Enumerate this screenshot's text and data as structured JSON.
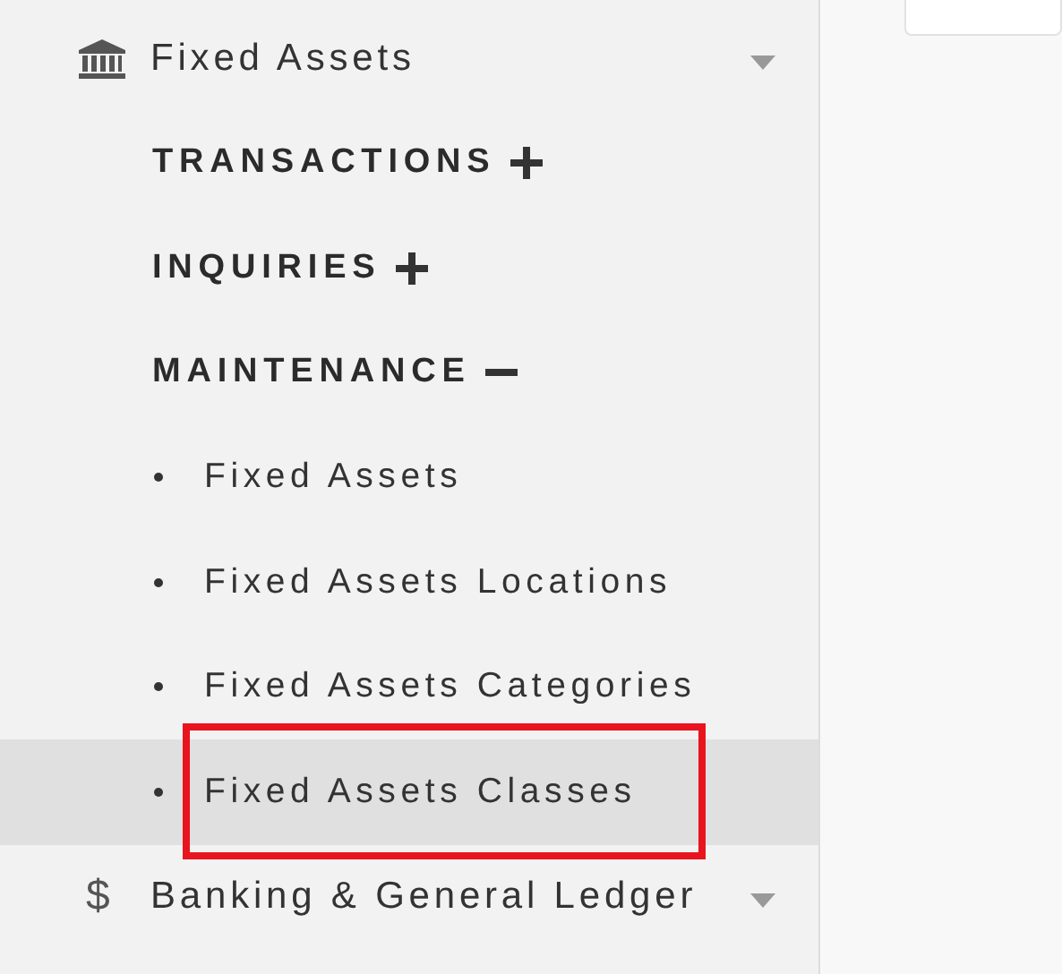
{
  "sidebar": {
    "items": [
      {
        "label": "Fixed Assets",
        "icon": {
          "kind": "bank"
        },
        "expanded": true,
        "sections": [
          {
            "label": "TRANSACTIONS",
            "expanded": false
          },
          {
            "label": "INQUIRIES",
            "expanded": false
          },
          {
            "label": "MAINTENANCE",
            "expanded": true,
            "children": [
              {
                "label": "Fixed Assets",
                "selected": false,
                "annotated": false
              },
              {
                "label": "Fixed Assets Locations",
                "selected": false,
                "annotated": false
              },
              {
                "label": "Fixed Assets Categories",
                "selected": false,
                "annotated": false
              },
              {
                "label": "Fixed Assets Classes",
                "selected": true,
                "annotated": true
              }
            ]
          }
        ]
      },
      {
        "label": "Banking & General Ledger",
        "icon": {
          "kind": "glyph",
          "text": "$"
        },
        "expanded": false
      }
    ]
  }
}
